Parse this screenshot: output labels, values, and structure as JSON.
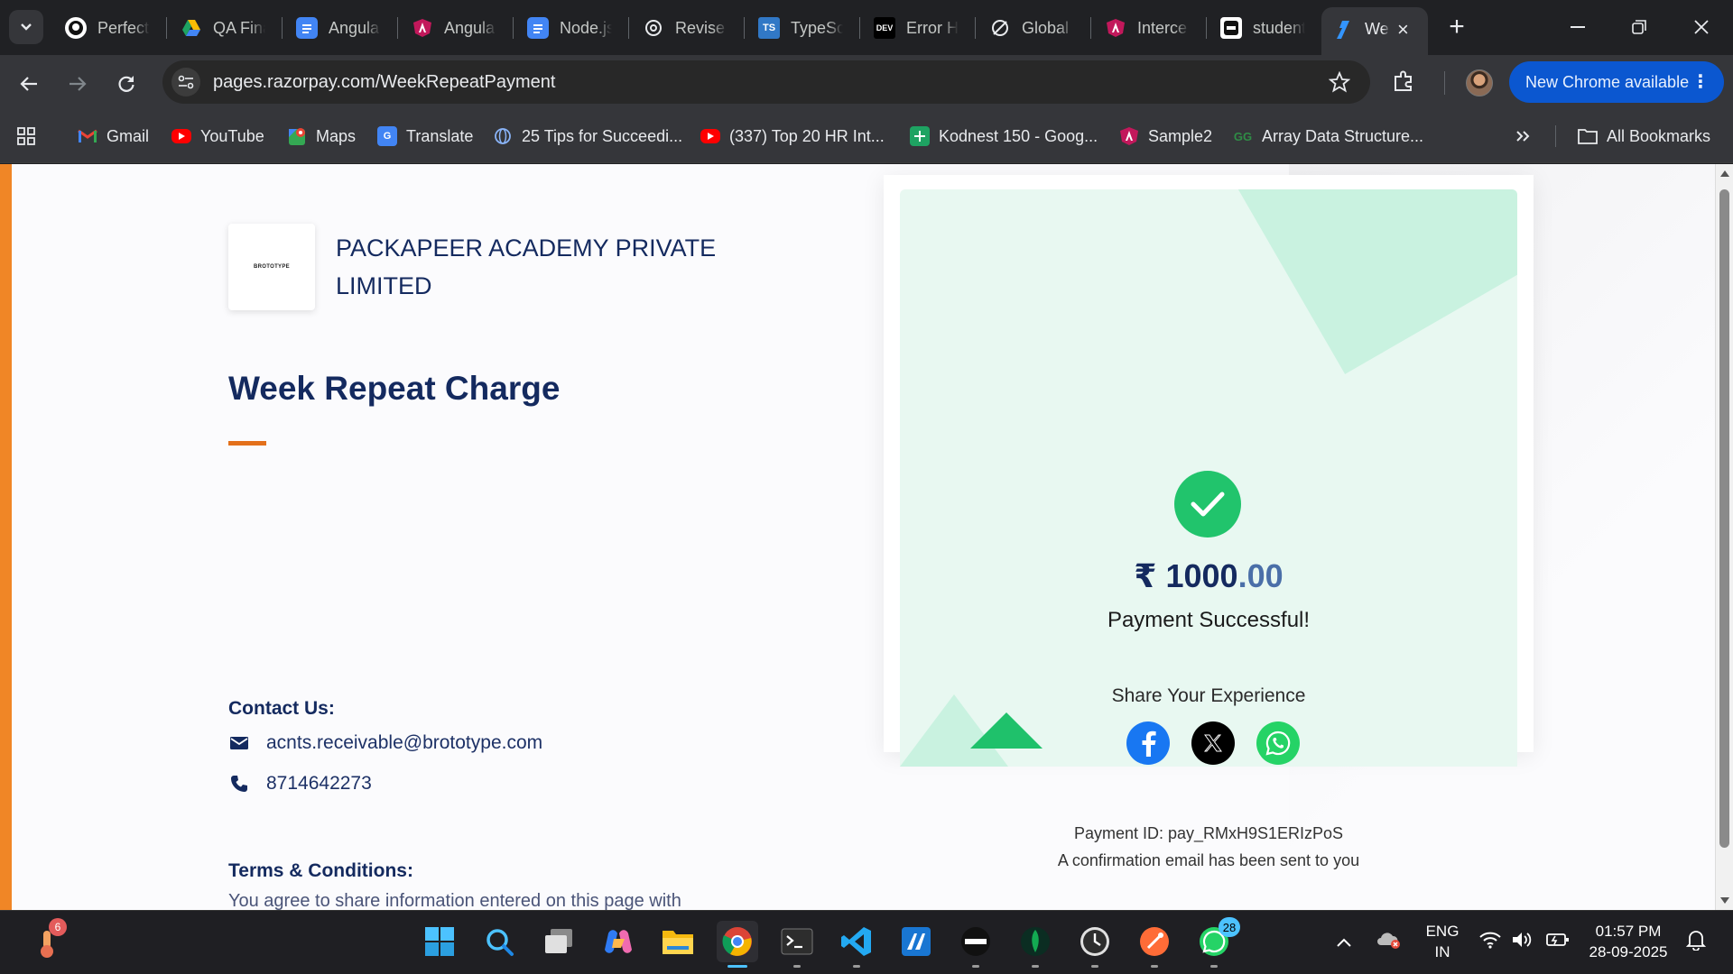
{
  "browser": {
    "tabs": [
      {
        "title": "Perfect",
        "icon": "github-icon"
      },
      {
        "title": "QA Fina",
        "icon": "google-drive-icon"
      },
      {
        "title": "Angula",
        "icon": "google-docs-icon"
      },
      {
        "title": "Angula",
        "icon": "angular-icon"
      },
      {
        "title": "Node.js",
        "icon": "google-docs-icon"
      },
      {
        "title": "Revise",
        "icon": "openai-icon"
      },
      {
        "title": "TypeSc",
        "icon": "typescript-icon"
      },
      {
        "title": "Error H",
        "icon": "dev-icon"
      },
      {
        "title": "Global",
        "icon": "global-icon"
      },
      {
        "title": "Interce",
        "icon": "angular-icon"
      },
      {
        "title": "student",
        "icon": "student-site-icon"
      },
      {
        "title": "We",
        "icon": "razorpay-icon",
        "active": true
      }
    ],
    "new_tab_label": "+",
    "address_url": "pages.razorpay.com/WeekRepeatPayment",
    "new_chrome_label": "New Chrome available",
    "bookmarks": [
      {
        "label": "Gmail",
        "icon": "gmail-icon"
      },
      {
        "label": "YouTube",
        "icon": "youtube-icon"
      },
      {
        "label": "Maps",
        "icon": "maps-icon"
      },
      {
        "label": "Translate",
        "icon": "translate-icon"
      },
      {
        "label": "25 Tips for Succeedi...",
        "icon": "globe-icon"
      },
      {
        "label": "(337) Top 20 HR Int...",
        "icon": "youtube-icon"
      },
      {
        "label": "Kodnest 150 - Goog...",
        "icon": "sheets-icon"
      },
      {
        "label": "Sample2",
        "icon": "angular-icon"
      },
      {
        "label": "Array Data Structure...",
        "icon": "gfg-icon"
      }
    ],
    "all_bookmarks_label": "All Bookmarks"
  },
  "page": {
    "merchant_name": "PACKAPEER ACADEMY PRIVATE LIMITED",
    "logo_text": "BROTOTYPE",
    "title": "Week Repeat Charge",
    "contact": {
      "heading": "Contact Us:",
      "email": "acnts.receivable@brototype.com",
      "phone": "8714642273"
    },
    "terms": {
      "heading": "Terms & Conditions:",
      "text": "You agree to share information entered on this page with"
    }
  },
  "payment": {
    "currency_symbol": "₹",
    "amount_whole": "1000",
    "amount_decimal": ".00",
    "status": "Payment Successful!",
    "share_heading": "Share Your Experience",
    "share_icons": [
      "facebook-icon",
      "x-twitter-icon",
      "whatsapp-icon"
    ],
    "payment_id_label": "Payment ID: pay_RMxH9S1ERIzPoS",
    "confirmation": "A confirmation email has been sent to you"
  },
  "taskbar": {
    "weather_badge": "6",
    "whatsapp_badge": "28",
    "lang_line1": "ENG",
    "lang_line2": "IN",
    "time": "01:57 PM",
    "date": "28-09-2025"
  },
  "colors": {
    "accent_orange": "#f08626",
    "title_navy": "#142a5f",
    "success_green": "#21c46c",
    "card_bg": "#e8f8f1",
    "chrome_blue": "#0b57d0"
  }
}
